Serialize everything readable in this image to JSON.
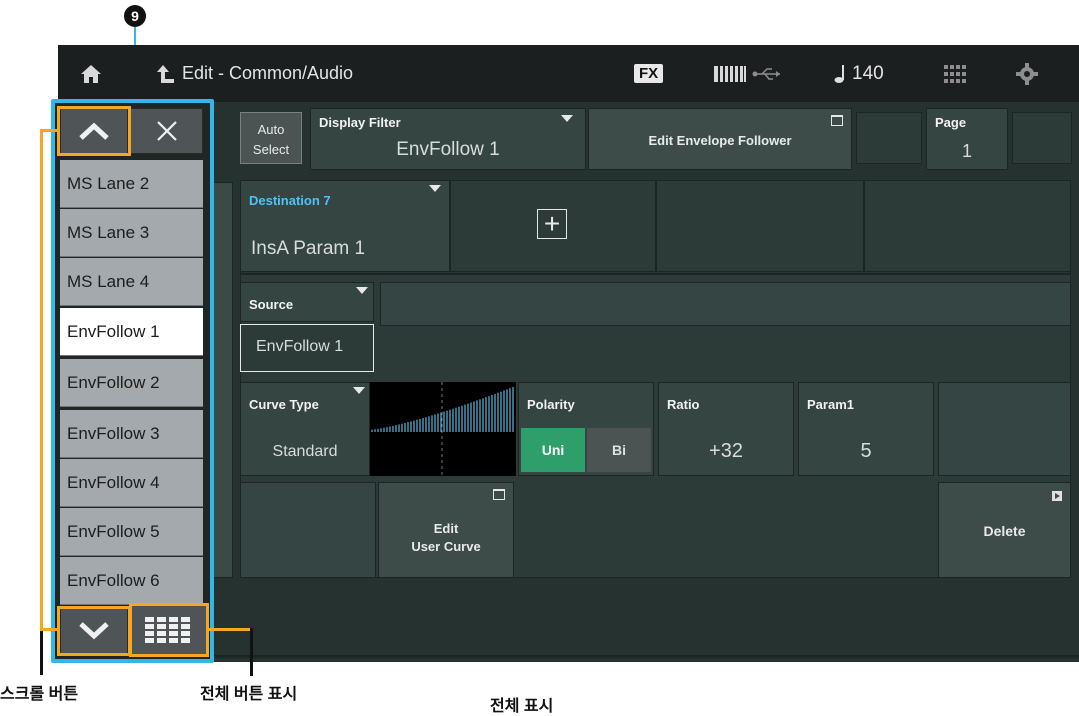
{
  "callout_number": "9",
  "topbar": {
    "title": "Edit - Common/Audio",
    "fx_label": "FX",
    "tempo": "140",
    "icons": [
      "home-icon",
      "back-arrow-icon",
      "keyboard-icon",
      "usb-icon",
      "note-icon",
      "grid-icon",
      "gear-icon"
    ]
  },
  "row1": {
    "auto_select_line1": "Auto",
    "auto_select_line2": "Select",
    "display_filter_label": "Display Filter",
    "display_filter_value": "EnvFollow 1",
    "edit_env_follower_label": "Edit Envelope Follower",
    "page_label": "Page",
    "page_value": "1"
  },
  "destination": {
    "label": "Destination 7",
    "value": "InsA Param 1",
    "add_symbol": "+"
  },
  "source": {
    "label": "Source",
    "value": "EnvFollow 1"
  },
  "curve": {
    "type_label": "Curve Type",
    "type_value": "Standard",
    "polarity_label": "Polarity",
    "polarity_uni": "Uni",
    "polarity_bi": "Bi",
    "polarity_selected": "Uni",
    "ratio_label": "Ratio",
    "ratio_value": "+32",
    "param1_label": "Param1",
    "param1_value": "5"
  },
  "actions": {
    "edit_user_curve_line1": "Edit",
    "edit_user_curve_line2": "User Curve",
    "delete_label": "Delete"
  },
  "list": {
    "items": [
      "MS Lane 2",
      "MS Lane 3",
      "MS Lane 4",
      "EnvFollow 1",
      "EnvFollow 2",
      "EnvFollow 3",
      "EnvFollow 4",
      "EnvFollow 5",
      "EnvFollow 6"
    ],
    "selected": "EnvFollow 1"
  },
  "annotations": {
    "scroll_buttons": "스크롤 버튼",
    "show_all_buttons": "전체 버튼 표시",
    "show_all": "전체 표시"
  },
  "colors": {
    "panel_outline": "#33b8e6",
    "highlight_orange": "#f5a623",
    "destination_label": "#4fc3f7",
    "polarity_active": "#2e9e6b"
  }
}
